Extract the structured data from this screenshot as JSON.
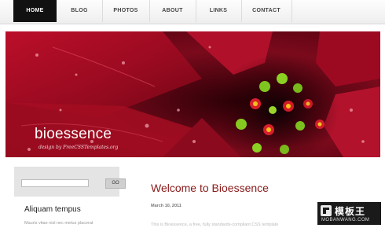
{
  "nav": {
    "items": [
      {
        "label": "HOME",
        "active": true
      },
      {
        "label": "BLOG",
        "active": false
      },
      {
        "label": "PHOTOS",
        "active": false
      },
      {
        "label": "ABOUT",
        "active": false
      },
      {
        "label": "LINKS",
        "active": false
      },
      {
        "label": "CONTACT",
        "active": false
      }
    ]
  },
  "header": {
    "site_title": "bioessence",
    "tagline": "design by FreeCSSTemplates.org"
  },
  "sidebar": {
    "search": {
      "placeholder": "",
      "button_label": "GO"
    },
    "heading": "Aliquam tempus",
    "text": "Mauris vitae nisl nec metus placerat"
  },
  "main": {
    "post_title": "Welcome to Bioessence",
    "post_date": "March 10, 2011",
    "body_preview": "This is Bioessence, a free, fully standards-compliant CSS template"
  },
  "watermark": {
    "cn_text": "模板王",
    "en_text": "MOBANWANG.COM"
  },
  "colors": {
    "accent": "#8b1a1a",
    "nav_active_bg": "#111111",
    "banner_base": "#5a0010"
  }
}
